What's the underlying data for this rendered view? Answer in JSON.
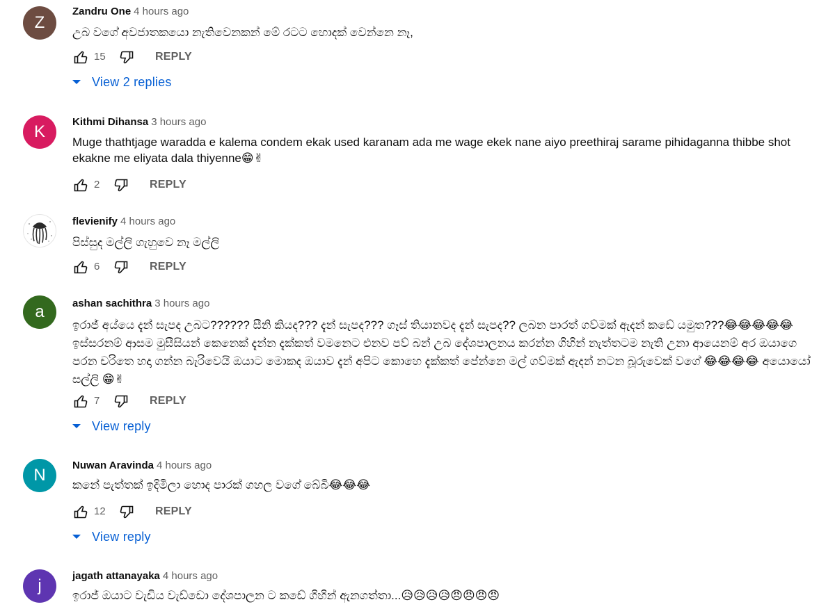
{
  "comments": [
    {
      "author": "Zandru One",
      "time": "4 hours ago",
      "avatar_letter": "Z",
      "avatar_color": "#6d4c41",
      "text": "උබ වගේ අවජාතකයො නැතිවෙනකන් මේ රටට හොදක් වෙන්නෙ නෑ,",
      "likes": "15",
      "reply": "REPLY",
      "replies_label": "View 2 replies"
    },
    {
      "author": "Kithmi Dihansa",
      "time": "3 hours ago",
      "avatar_letter": "K",
      "avatar_color": "#d81b60",
      "text": "Muge thathtjage waradda e kalema condem ekak used karanam ada me wage ekek nane aiyo preethiraj sarame  pihidaganna thibbe shot ekakne me eliyata dala thiyenne😁✌",
      "likes": "2",
      "reply": "REPLY"
    },
    {
      "author": "flevienify",
      "time": "4 hours ago",
      "text": "පිස්සුද මල්ලි ගැහුවෙ නෑ මල්ලි",
      "likes": "6",
      "reply": "REPLY"
    },
    {
      "author": "ashan sachithra",
      "time": "3 hours ago",
      "avatar_letter": "a",
      "avatar_color": "#33691e",
      "text": "ඉරාජ් අය්යෙ දැන් සැපද උබට?????? සීනි කියද??? දැන් සැපද??? ගෑස් තියානවද දැන් සැපද?? ලබන පාරත් ගව්මක් ඇදන් කඩේ යමුත???😂😂😂😂😂 ඉස්සරනම් ආසම මුසීසියන් කෙනෙක් දැන්න දැක්කත් වමනෙට එනව පව් බන් උබ දේශපාලනය කරන්න ගිහින් නැත්තටම නැති උනා ආයෙනම් අර ඔයාගෙ පරන චරිතෙ හදා ගන්න බැරිවෙයි ඔයාට මොකද ඔයාව දැන් අපිට කොහෙ දැක්කත් පේන්නෙ මල් ගව්මක් ඇදන් නටන බූරුවෙක් වගේ 😂😂😂😂 අයොයෝ සල්ලි 😁✌",
      "likes": "7",
      "reply": "REPLY",
      "replies_label": "View reply"
    },
    {
      "author": "Nuwan Aravinda",
      "time": "4 hours ago",
      "avatar_letter": "N",
      "avatar_color": "#0097a7",
      "text": "කනේ පැත්තක් ඉදිමිලා හොද පාරක් ගහල වගේ බේබි😂😂😂",
      "likes": "12",
      "reply": "REPLY",
      "replies_label": "View reply"
    },
    {
      "author": "jagath attanayaka",
      "time": "4 hours ago",
      "avatar_letter": "j",
      "avatar_color": "#5e35b1",
      "text": "ඉරාජ් ඔයාට වැඩිය වැඩ්ඩො දේශපාලන ට කඩේ ගිහින් ඇනගත්තා...😥😥😥😥😠😠😠😠"
    }
  ],
  "icons": {
    "like": "thumb-up-outline-icon",
    "dislike": "thumb-down-outline-icon",
    "expand": "arrow-drop-down-icon"
  },
  "colors": {
    "link_blue": "#065fd4",
    "secondary_text": "#606060",
    "primary_text": "#0f0f0f"
  }
}
